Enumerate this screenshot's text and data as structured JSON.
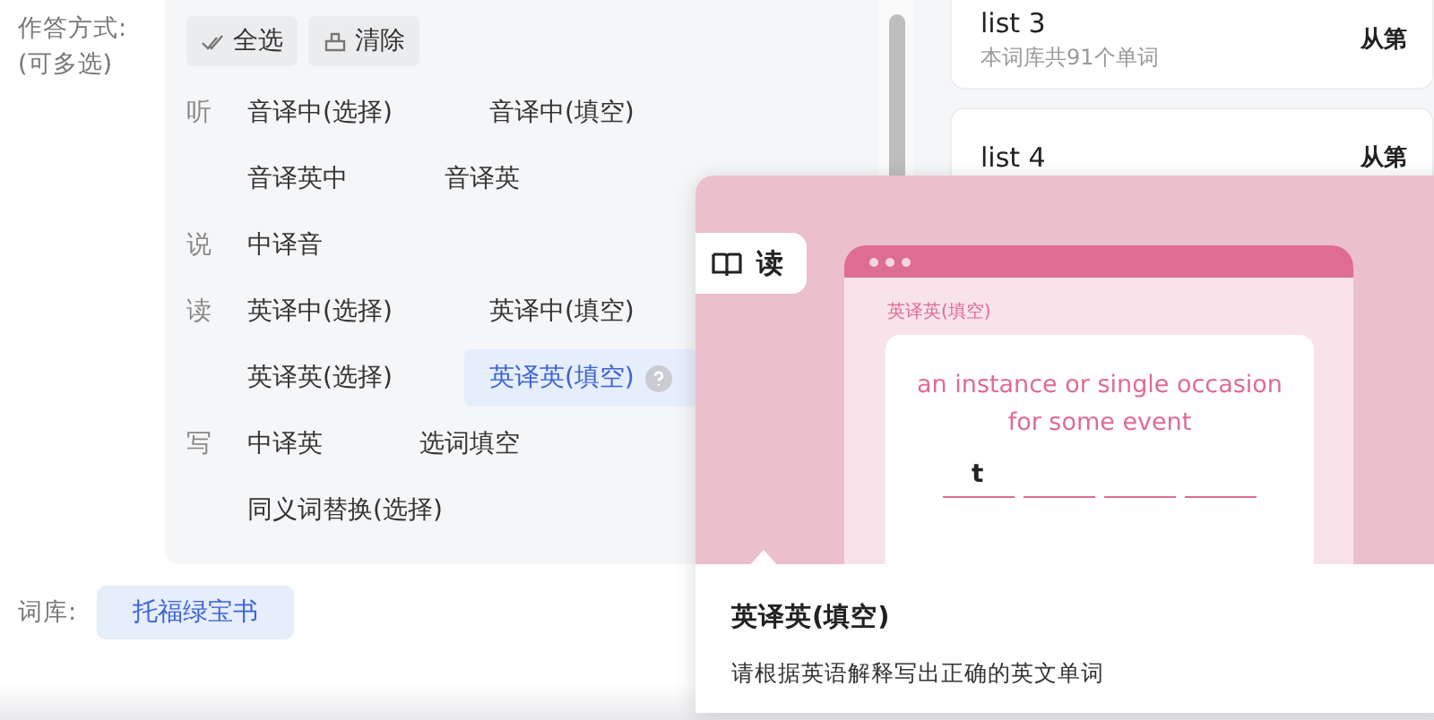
{
  "answer_mode": {
    "label": "作答方式:",
    "hint": "(可多选)",
    "buttons": [
      {
        "label": "全选",
        "kind": "select_all"
      },
      {
        "label": "清除",
        "kind": "clear"
      }
    ],
    "groups": [
      {
        "category": "听",
        "rows": [
          [
            {
              "label": "音译中(选择)",
              "selected": false
            },
            {
              "label": "音译中(填空)",
              "selected": false
            }
          ],
          [
            {
              "label": "音译英中",
              "selected": false
            },
            {
              "label": "音译英",
              "selected": false
            }
          ]
        ]
      },
      {
        "category": "说",
        "rows": [
          [
            {
              "label": "中译音",
              "selected": false
            }
          ]
        ]
      },
      {
        "category": "读",
        "rows": [
          [
            {
              "label": "英译中(选择)",
              "selected": false
            },
            {
              "label": "英译中(填空)",
              "selected": false
            }
          ],
          [
            {
              "label": "英译英(选择)",
              "selected": false
            },
            {
              "label": "英译英(填空)",
              "selected": true
            }
          ]
        ]
      },
      {
        "category": "写",
        "rows": [
          [
            {
              "label": "中译英",
              "selected": false
            },
            {
              "label": "选词填空",
              "selected": false
            }
          ],
          [
            {
              "label": "同义词替换(选择)",
              "selected": false
            }
          ]
        ]
      }
    ]
  },
  "library": {
    "label": "词库:",
    "value": "托福绿宝书"
  },
  "word_lists": [
    {
      "title": "list 3",
      "subtitle": "本词库共91个单词",
      "action": "从第"
    },
    {
      "title": "list 4",
      "action": "从第"
    }
  ],
  "popover": {
    "tab": "读",
    "preview": {
      "mode_label": "英译英(填空)",
      "definition": "an instance or single occasion for some event",
      "slots": [
        {
          "kind": "letter",
          "letter": "t"
        },
        {
          "kind": "blank"
        },
        {
          "kind": "blank"
        },
        {
          "kind": "blank"
        }
      ]
    },
    "title": "英译英(填空)",
    "description": "请根据英语解释写出正确的英文单词"
  }
}
